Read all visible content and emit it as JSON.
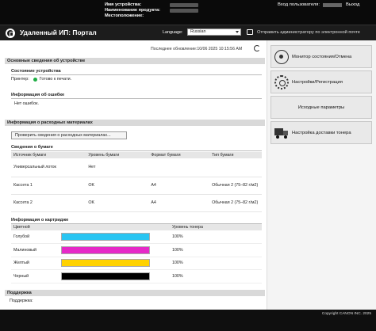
{
  "header": {
    "device_name_label": "Имя устройства:",
    "product_name_label": "Наименование продукта:",
    "location_label": "Местоположение:",
    "device_name_value": "",
    "product_name_value": "",
    "login_user_label": "Вход пользователя:",
    "logout_label": "Выход"
  },
  "portal": {
    "title": "Удаленный ИП: Портал",
    "language_label": "Language:",
    "language_value": "Russian",
    "mail_admin_link": "Отправить администратору по электронной почте"
  },
  "main": {
    "last_update": "Последнее обновление:10/06 2025 10:15:56 AM",
    "basic_info": {
      "title": "Основные сведения об устройстве",
      "device_state_heading": "Состояние устройства",
      "printer_label": "Принтер:",
      "printer_status": "Готово к печати.",
      "error_info_heading": "Информация об ошибке",
      "error_text": "Нет ошибок."
    },
    "consumables": {
      "title": "Информация о расходных материалах",
      "check_button": "Проверить сведения о расходных материалах...",
      "paper_heading": "Сведения о бумаге",
      "paper_columns": [
        "Источник бумаги",
        "Уровень бумаги",
        "Формат бумаги",
        "Тип бумаги"
      ],
      "paper_rows": [
        {
          "source": "Универсальный лоток",
          "level": "Нет",
          "format": "",
          "type": ""
        },
        {
          "source": "Кассета 1",
          "level": "OK",
          "format": "A4",
          "type": "Обычная 2 (75–82 г/м2)"
        },
        {
          "source": "Кассета 2",
          "level": "OK",
          "format": "A4",
          "type": "Обычная 2 (75–82 г/м2)"
        }
      ],
      "cartridge_heading": "Информация о картридже",
      "cartridge_columns": [
        "Цветной",
        "Уровень тонера"
      ],
      "cartridges": [
        {
          "name": "Голубой",
          "level": "100%",
          "color": "#29c5f2"
        },
        {
          "name": "Малиновый",
          "level": "100%",
          "color": "#e629c8"
        },
        {
          "name": "Желтый",
          "level": "100%",
          "color": "#ffd200"
        },
        {
          "name": "Черный",
          "level": "100%",
          "color": "#000000"
        }
      ]
    },
    "support": {
      "title": "Поддержка",
      "label": "Поддержка:"
    }
  },
  "sidebar": {
    "buttons": [
      {
        "label": "Монитор состояния/Отмена",
        "icon": "eye-icon"
      },
      {
        "label": "Настройки/Регистрация",
        "icon": "gear-icon"
      },
      {
        "label": "Исходные параметры",
        "icon": ""
      },
      {
        "label": "Настройка доставки тонера",
        "icon": "truck-icon"
      }
    ]
  },
  "footer": {
    "copyright": "Copyright CANON INC. 2025"
  }
}
